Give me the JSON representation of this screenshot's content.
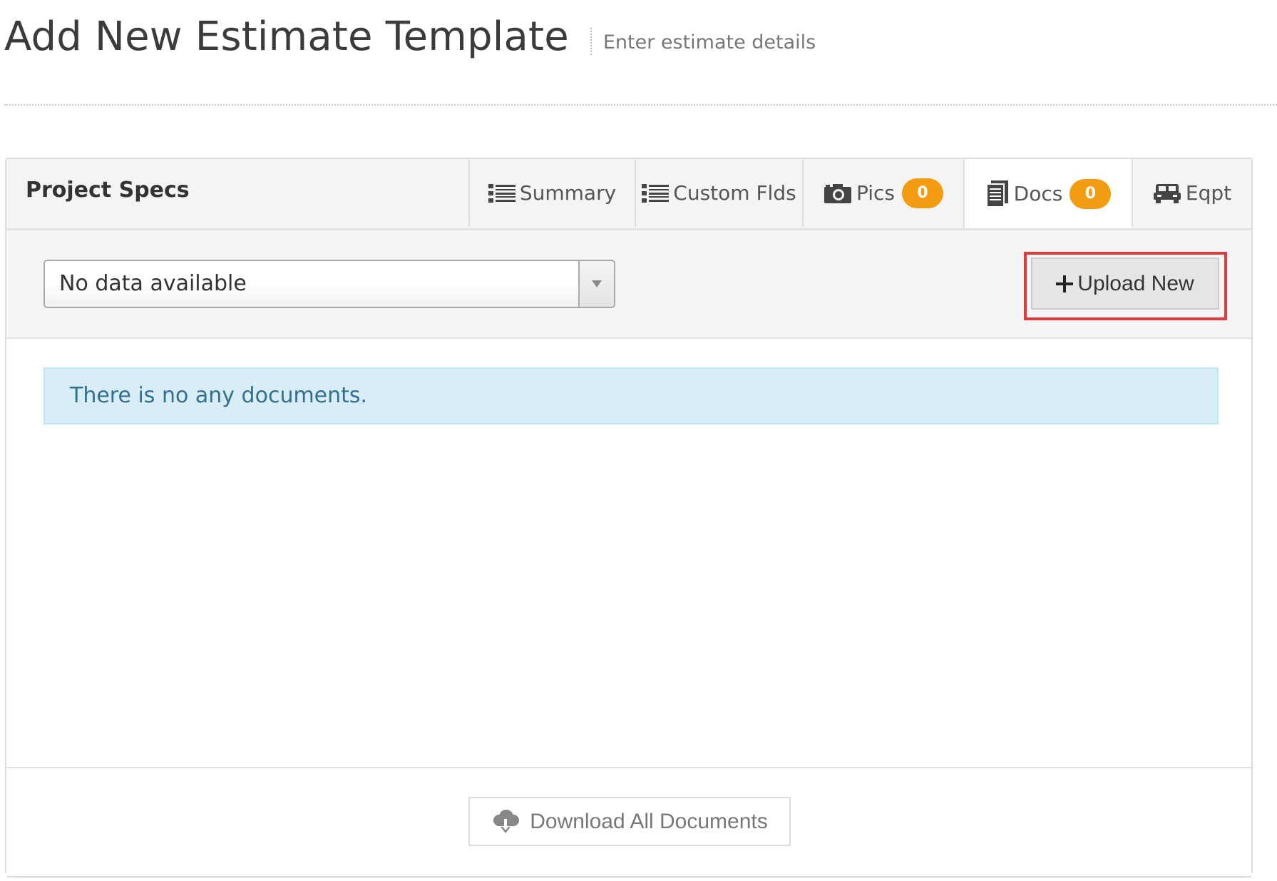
{
  "header": {
    "title": "Add New Estimate Template",
    "subtitle": "Enter estimate details"
  },
  "portlet": {
    "caption": "Project Specs",
    "tabs": [
      {
        "label": "Summary",
        "icon": "list-icon",
        "active": false
      },
      {
        "label": "Custom Flds",
        "icon": "list-icon",
        "active": false
      },
      {
        "label": "Pics",
        "icon": "camera-icon",
        "badge": "0",
        "active": false
      },
      {
        "label": "Docs",
        "icon": "document-icon",
        "badge": "0",
        "active": true
      },
      {
        "label": "Eqpt",
        "icon": "truck-icon",
        "active": false
      }
    ],
    "badge_color": "#f39c12"
  },
  "toolbar": {
    "select_value": "No data available",
    "upload_label": "Upload New",
    "highlight_color": "#e0393e"
  },
  "body": {
    "empty_message": "There is no any documents."
  },
  "footer": {
    "download_label": "Download All Documents"
  }
}
